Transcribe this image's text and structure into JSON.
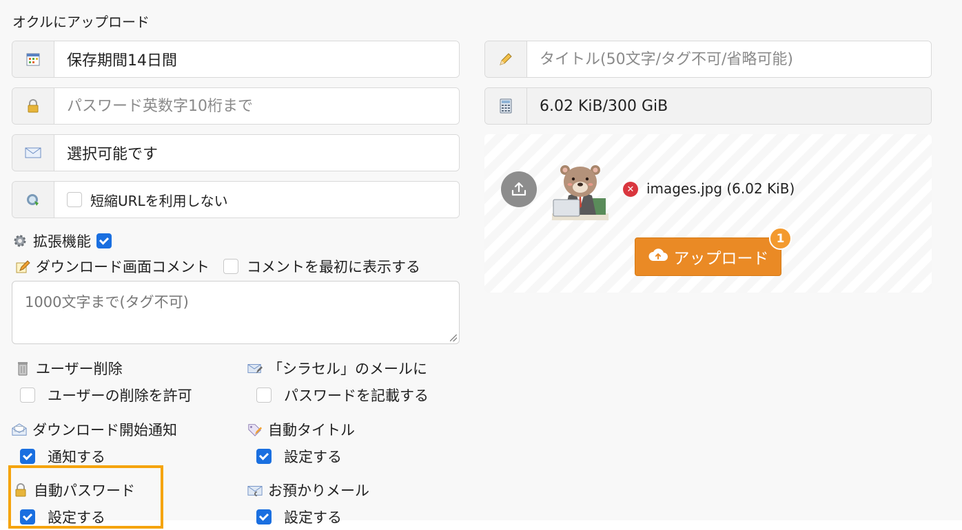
{
  "page_title": "オクルにアップロード",
  "fields": {
    "retention": {
      "icon": "calendar-icon",
      "value": "保存期間14日間"
    },
    "password": {
      "icon": "lock-icon",
      "placeholder": "パスワード英数字10桁まで"
    },
    "mail": {
      "icon": "envelope-icon",
      "value": "選択可能です"
    },
    "short_url": {
      "icon": "link-refresh-icon",
      "label": "短縮URLを利用しない",
      "checked": false
    },
    "title": {
      "icon": "pencil-icon",
      "placeholder": "タイトル(50文字/タグ不可/省略可能)"
    },
    "capacity": {
      "icon": "calculator-icon",
      "value": "6.02 KiB/300 GiB"
    }
  },
  "extended": {
    "icon": "gear-icon",
    "label": "拡張機能",
    "checked": true
  },
  "download_comment": {
    "icon": "pencil-note-icon",
    "label": "ダウンロード画面コメント",
    "show_first_label": "コメントを最初に表示する",
    "show_first_checked": false,
    "placeholder": "1000文字まで(タグ不可)"
  },
  "options": {
    "user_delete": {
      "icon": "trash-icon",
      "title": "ユーザー削除",
      "label": "ユーザーの削除を許可",
      "checked": false
    },
    "shirasel_mail": {
      "icon": "mail-edit-icon",
      "title": "「シラセル」のメールに",
      "label": "パスワードを記載する",
      "checked": false
    },
    "download_notify": {
      "icon": "open-mail-icon",
      "title": "ダウンロード開始通知",
      "label": "通知する",
      "checked": true
    },
    "auto_title": {
      "icon": "tag-pencil-icon",
      "title": "自動タイトル",
      "label": "設定する",
      "checked": true
    },
    "auto_password": {
      "icon": "lock-icon",
      "title": "自動パスワード",
      "label": "設定する",
      "checked": true
    },
    "deposit_mail": {
      "icon": "mail-clip-icon",
      "title": "お預かりメール",
      "label": "設定する",
      "checked": true
    }
  },
  "upload": {
    "file_name": "images.jpg (6.02 KiB)",
    "button_label": "アップロード",
    "badge_count": "1"
  },
  "colors": {
    "accent": "#ea8a25",
    "checkbox": "#1a6fe0",
    "highlight": "#f5a40c",
    "remove": "#d9363e"
  }
}
